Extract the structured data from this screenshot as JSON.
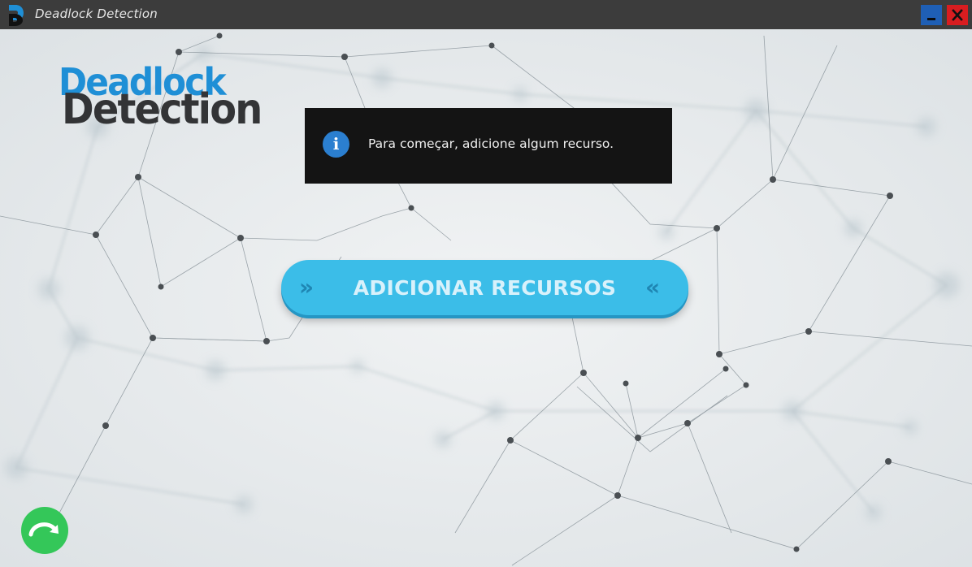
{
  "window": {
    "title": "Deadlock Detection",
    "app_icon": "deadlock-d-icon",
    "minimize_icon": "minimize-icon",
    "close_icon": "close-icon",
    "colors": {
      "titlebar": "#3c3c3c",
      "minimize": "#1f5fb5",
      "close": "#d81d20"
    }
  },
  "logo": {
    "line1": "Deadlock",
    "line2": "Detection",
    "colors": {
      "line1": "#1f8fd6",
      "line2": "#333436"
    }
  },
  "info": {
    "icon": "info-icon",
    "icon_glyph": "i",
    "message": "Para começar, adicione algum recurso."
  },
  "add_button": {
    "label": "ADICIONAR RECURSOS",
    "left_chevrons": "»",
    "right_chevrons": "«",
    "color": "#3bbde8"
  },
  "next_button": {
    "icon": "arrow-redo-icon",
    "color": "#34c759"
  }
}
